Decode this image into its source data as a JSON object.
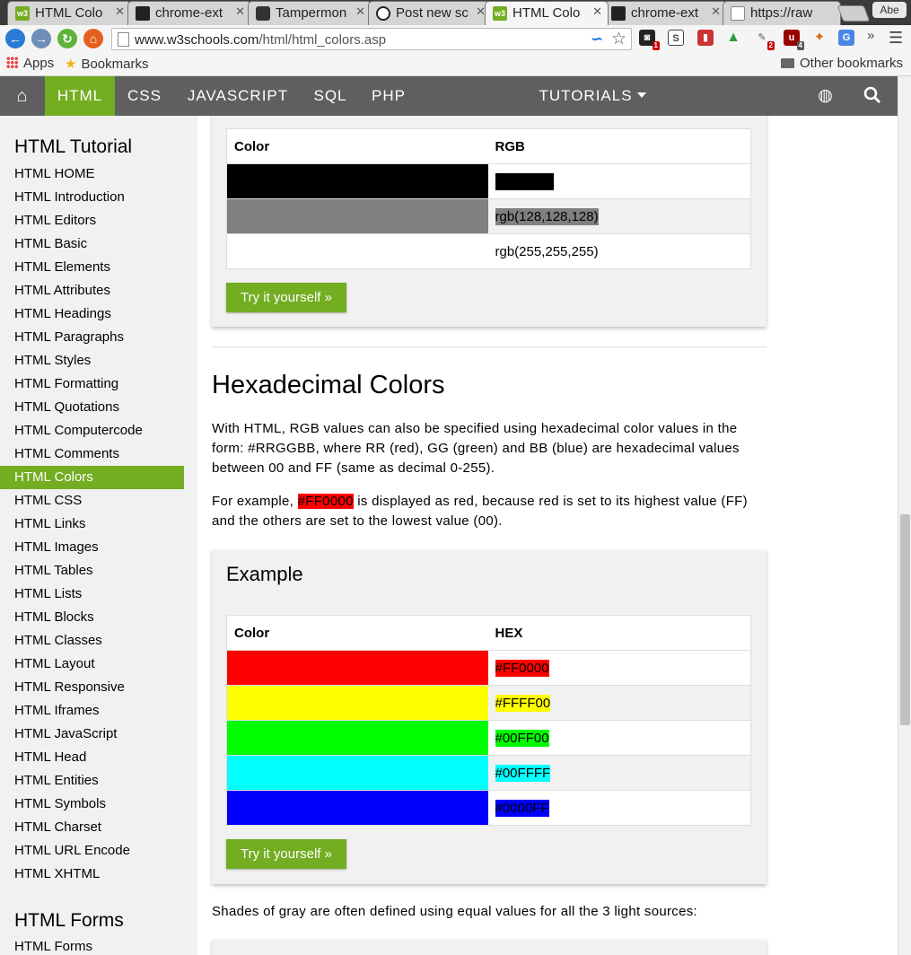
{
  "browser": {
    "tabs": [
      {
        "label": "HTML Colo",
        "favicon": "w3schools-favicon",
        "active": false
      },
      {
        "label": "chrome-ext",
        "favicon": "github-favicon",
        "active": false
      },
      {
        "label": "Tampermon",
        "favicon": "tampermonkey-favicon",
        "active": false
      },
      {
        "label": "Post new sc",
        "favicon": "wordpress-favicon",
        "active": false
      },
      {
        "label": "HTML Colo",
        "favicon": "w3schools-favicon",
        "active": true
      },
      {
        "label": "chrome-ext",
        "favicon": "github-favicon",
        "active": false
      },
      {
        "label": "https://raw",
        "favicon": "document-favicon",
        "active": false
      }
    ],
    "profile_name": "Abe",
    "address_bar": {
      "host": "www.w3schools.com",
      "path": "/html/html_colors.asp"
    },
    "bookmarks": {
      "apps_label": "Apps",
      "bookmarks_label": "Bookmarks",
      "other_label": "Other bookmarks"
    },
    "overflow_label": "»"
  },
  "topnav": {
    "items": [
      "HTML",
      "CSS",
      "JAVASCRIPT",
      "SQL",
      "PHP"
    ],
    "tutorials_label": "TUTORIALS"
  },
  "sidebar": {
    "heading": "HTML Tutorial",
    "items": [
      "HTML HOME",
      "HTML Introduction",
      "HTML Editors",
      "HTML Basic",
      "HTML Elements",
      "HTML Attributes",
      "HTML Headings",
      "HTML Paragraphs",
      "HTML Styles",
      "HTML Formatting",
      "HTML Quotations",
      "HTML Computercode",
      "HTML Comments",
      "HTML Colors",
      "HTML CSS",
      "HTML Links",
      "HTML Images",
      "HTML Tables",
      "HTML Lists",
      "HTML Blocks",
      "HTML Classes",
      "HTML Layout",
      "HTML Responsive",
      "HTML Iframes",
      "HTML JavaScript",
      "HTML Head",
      "HTML Entities",
      "HTML Symbols",
      "HTML Charset",
      "HTML URL Encode",
      "HTML XHTML"
    ],
    "active_index": 13,
    "heading2": "HTML Forms",
    "items2": [
      "HTML Forms"
    ]
  },
  "rgb_table": {
    "header": {
      "color": "Color",
      "value": "RGB"
    },
    "rows": [
      {
        "swatch": "#000000",
        "value": "rgb(0,0,0)",
        "text_color": "#000000",
        "bg": "#000000"
      },
      {
        "swatch": "#808080",
        "value": "rgb(128,128,128)",
        "text_color": "#000000",
        "bg": "#808080"
      },
      {
        "swatch": "#ffffff",
        "value": "rgb(255,255,255)",
        "text_color": "#000000",
        "bg": ""
      }
    ],
    "button": "Try it yourself »"
  },
  "hex_section": {
    "heading": "Hexadecimal Colors",
    "intro": "With HTML, RGB values can also be specified using hexadecimal color values in the form: #RRGGBB, where RR (red), GG (green) and BB (blue) are hexadecimal values between 00 and FF (same as decimal 0-255).",
    "example_prefix": "For example, ",
    "example_code": "#FF0000",
    "example_suffix": " is displayed as red, because red is set to its highest value (FF) and the others are set to the lowest value (00)."
  },
  "hex_example": {
    "title": "Example",
    "header": {
      "color": "Color",
      "value": "HEX"
    },
    "rows": [
      {
        "swatch": "#FF0000",
        "value": "#FF0000",
        "text_color": "#000000",
        "bg": "#FF0000"
      },
      {
        "swatch": "#FFFF00",
        "value": "#FFFF00",
        "text_color": "#000000",
        "bg": "#FFFF00"
      },
      {
        "swatch": "#00FF00",
        "value": "#00FF00",
        "text_color": "#000000",
        "bg": "#00FF00"
      },
      {
        "swatch": "#00FFFF",
        "value": "#00FFFF",
        "text_color": "#000000",
        "bg": "#00FFFF"
      },
      {
        "swatch": "#0000FF",
        "value": "#0000FF",
        "text_color": "#000000",
        "bg": "#0000FF"
      }
    ],
    "button": "Try it yourself »"
  },
  "gray_intro": "Shades of gray are often defined using equal values for all the 3 light sources:",
  "colors": {
    "accent": "#73ad21",
    "topnav": "#5f5f5f",
    "sidebar": "#f1f1f1"
  }
}
